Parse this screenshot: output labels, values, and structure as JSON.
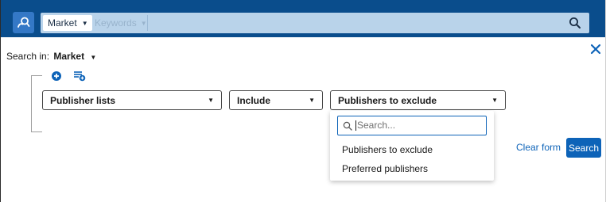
{
  "topbar": {
    "scope_chip": "Market",
    "keywords_chip": "Keywords",
    "search_value": ""
  },
  "search_in": {
    "label": "Search in:",
    "value": "Market"
  },
  "builder": {
    "field_select": "Publisher lists",
    "operator_select": "Include",
    "value_select": "Publishers to exclude"
  },
  "dropdown": {
    "search_placeholder": "Search...",
    "options": [
      "Publishers to exclude",
      "Preferred publishers"
    ]
  },
  "actions": {
    "clear_label": "Clear form",
    "search_label": "Search"
  },
  "colors": {
    "topbar_bg": "#0a4d8c",
    "search_bar_bg": "#b9d3ea",
    "accent": "#0d63b8"
  },
  "icons": [
    "person-search-icon",
    "chevron-down-icon",
    "search-icon",
    "close-icon",
    "add-circle-icon",
    "add-group-icon"
  ]
}
